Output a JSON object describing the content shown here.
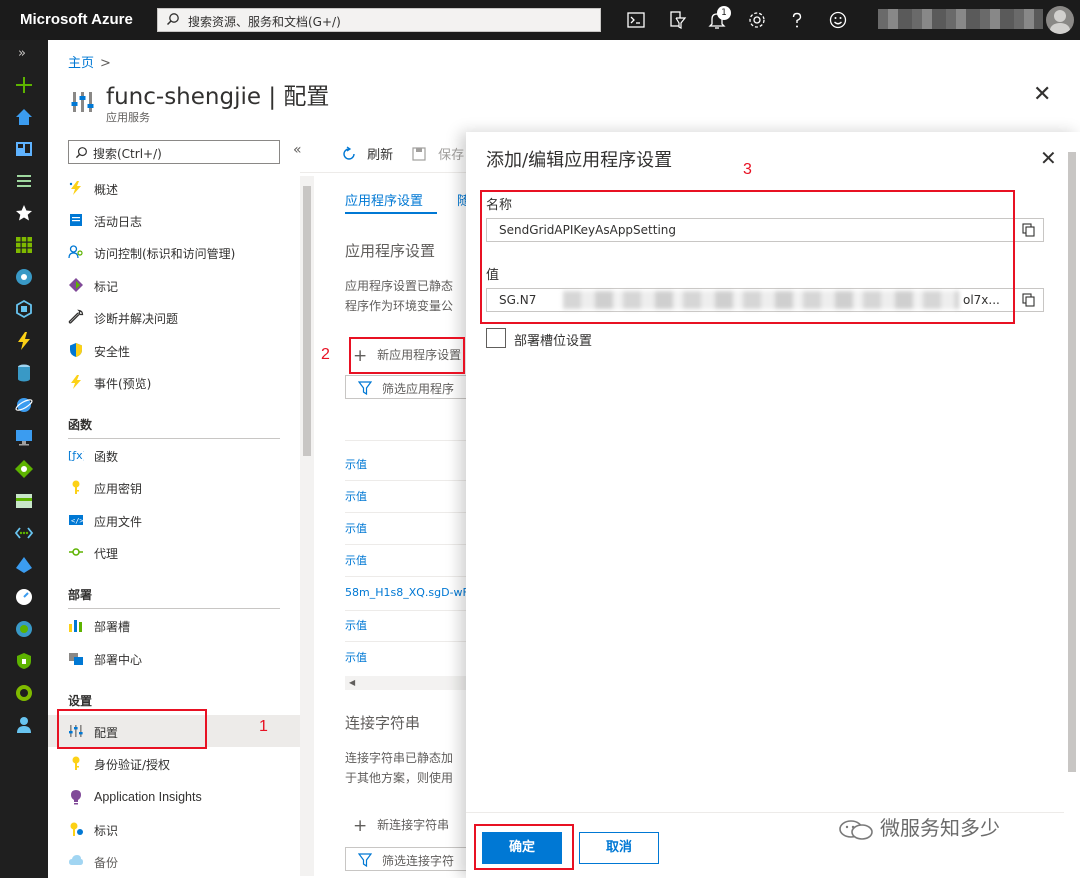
{
  "topbar": {
    "brand": "Microsoft Azure",
    "search_placeholder": "搜索资源、服务和文档(G+/)",
    "notification_count": "1",
    "icons": [
      "cloud-shell-icon",
      "directory-filter-icon",
      "bell-icon",
      "gear-icon",
      "help-icon",
      "feedback-icon"
    ]
  },
  "breadcrumb": {
    "home": "主页",
    "separator": ">"
  },
  "page": {
    "title": "func-shengjie | 配置",
    "subtitle": "应用服务"
  },
  "menu": {
    "search_placeholder": "搜索(Ctrl+/)",
    "collapse": "«",
    "top_items": [
      {
        "label": "概述",
        "icon": "overview-icon"
      },
      {
        "label": "活动日志",
        "icon": "activity-log-icon"
      },
      {
        "label": "访问控制(标识和访问管理)",
        "icon": "iam-icon"
      },
      {
        "label": "标记",
        "icon": "tag-icon"
      },
      {
        "label": "诊断并解决问题",
        "icon": "wrench-icon"
      },
      {
        "label": "安全性",
        "icon": "shield-icon"
      },
      {
        "label": "事件(预览)",
        "icon": "bolt-icon"
      }
    ],
    "section_functions": "函数",
    "functions_items": [
      {
        "label": "函数",
        "icon": "function-icon"
      },
      {
        "label": "应用密钥",
        "icon": "key-icon"
      },
      {
        "label": "应用文件",
        "icon": "code-file-icon"
      },
      {
        "label": "代理",
        "icon": "proxy-icon"
      }
    ],
    "section_deploy": "部署",
    "deploy_items": [
      {
        "label": "部署槽",
        "icon": "slots-icon"
      },
      {
        "label": "部署中心",
        "icon": "deploy-center-icon"
      }
    ],
    "section_settings": "设置",
    "settings_items": [
      {
        "label": "配置",
        "icon": "configuration-icon"
      },
      {
        "label": "身份验证/授权",
        "icon": "auth-key-icon"
      },
      {
        "label": "Application Insights",
        "icon": "insights-icon"
      },
      {
        "label": "标识",
        "icon": "identity-icon"
      },
      {
        "label": "备份",
        "icon": "backup-icon"
      }
    ]
  },
  "content": {
    "toolbar": {
      "refresh": "刷新",
      "save": "保存"
    },
    "tab_app_settings": "应用程序设置",
    "tab_second_initial": "随",
    "heading_app_settings": "应用程序设置",
    "desc_app_1": "应用程序设置已静态",
    "desc_app_2": "程序作为环境变量公",
    "new_app_setting": "新应用程序设置",
    "filter_placeholder": "筛选应用程序",
    "rows": [
      "示值",
      "示值",
      "示值",
      "示值",
      "58m_H1s8_XQ.sgD-wF",
      "示值",
      "示值"
    ],
    "heading_conn": "连接字符串",
    "desc_conn_1": "连接字符串已静态加",
    "desc_conn_2": "于其他方案，则使用",
    "new_conn": "新连接字符串",
    "filter_conn_placeholder": "筛选连接字符"
  },
  "dialog": {
    "title": "添加/编辑应用程序设置",
    "name_label": "名称",
    "name_value": "SendGridAPIKeyAsAppSetting",
    "value_label": "值",
    "value_prefix": "SG.N7",
    "value_suffix": "ol7x...",
    "slot_setting_label": "部署槽位设置",
    "ok": "确定",
    "cancel": "取消"
  },
  "annotations": {
    "n1": "1",
    "n2": "2",
    "n3": "3"
  },
  "watermark": "微服务知多少",
  "colors": {
    "accent": "#0078d4",
    "annotation": "#e81123",
    "topbar": "#1b1b1b"
  }
}
